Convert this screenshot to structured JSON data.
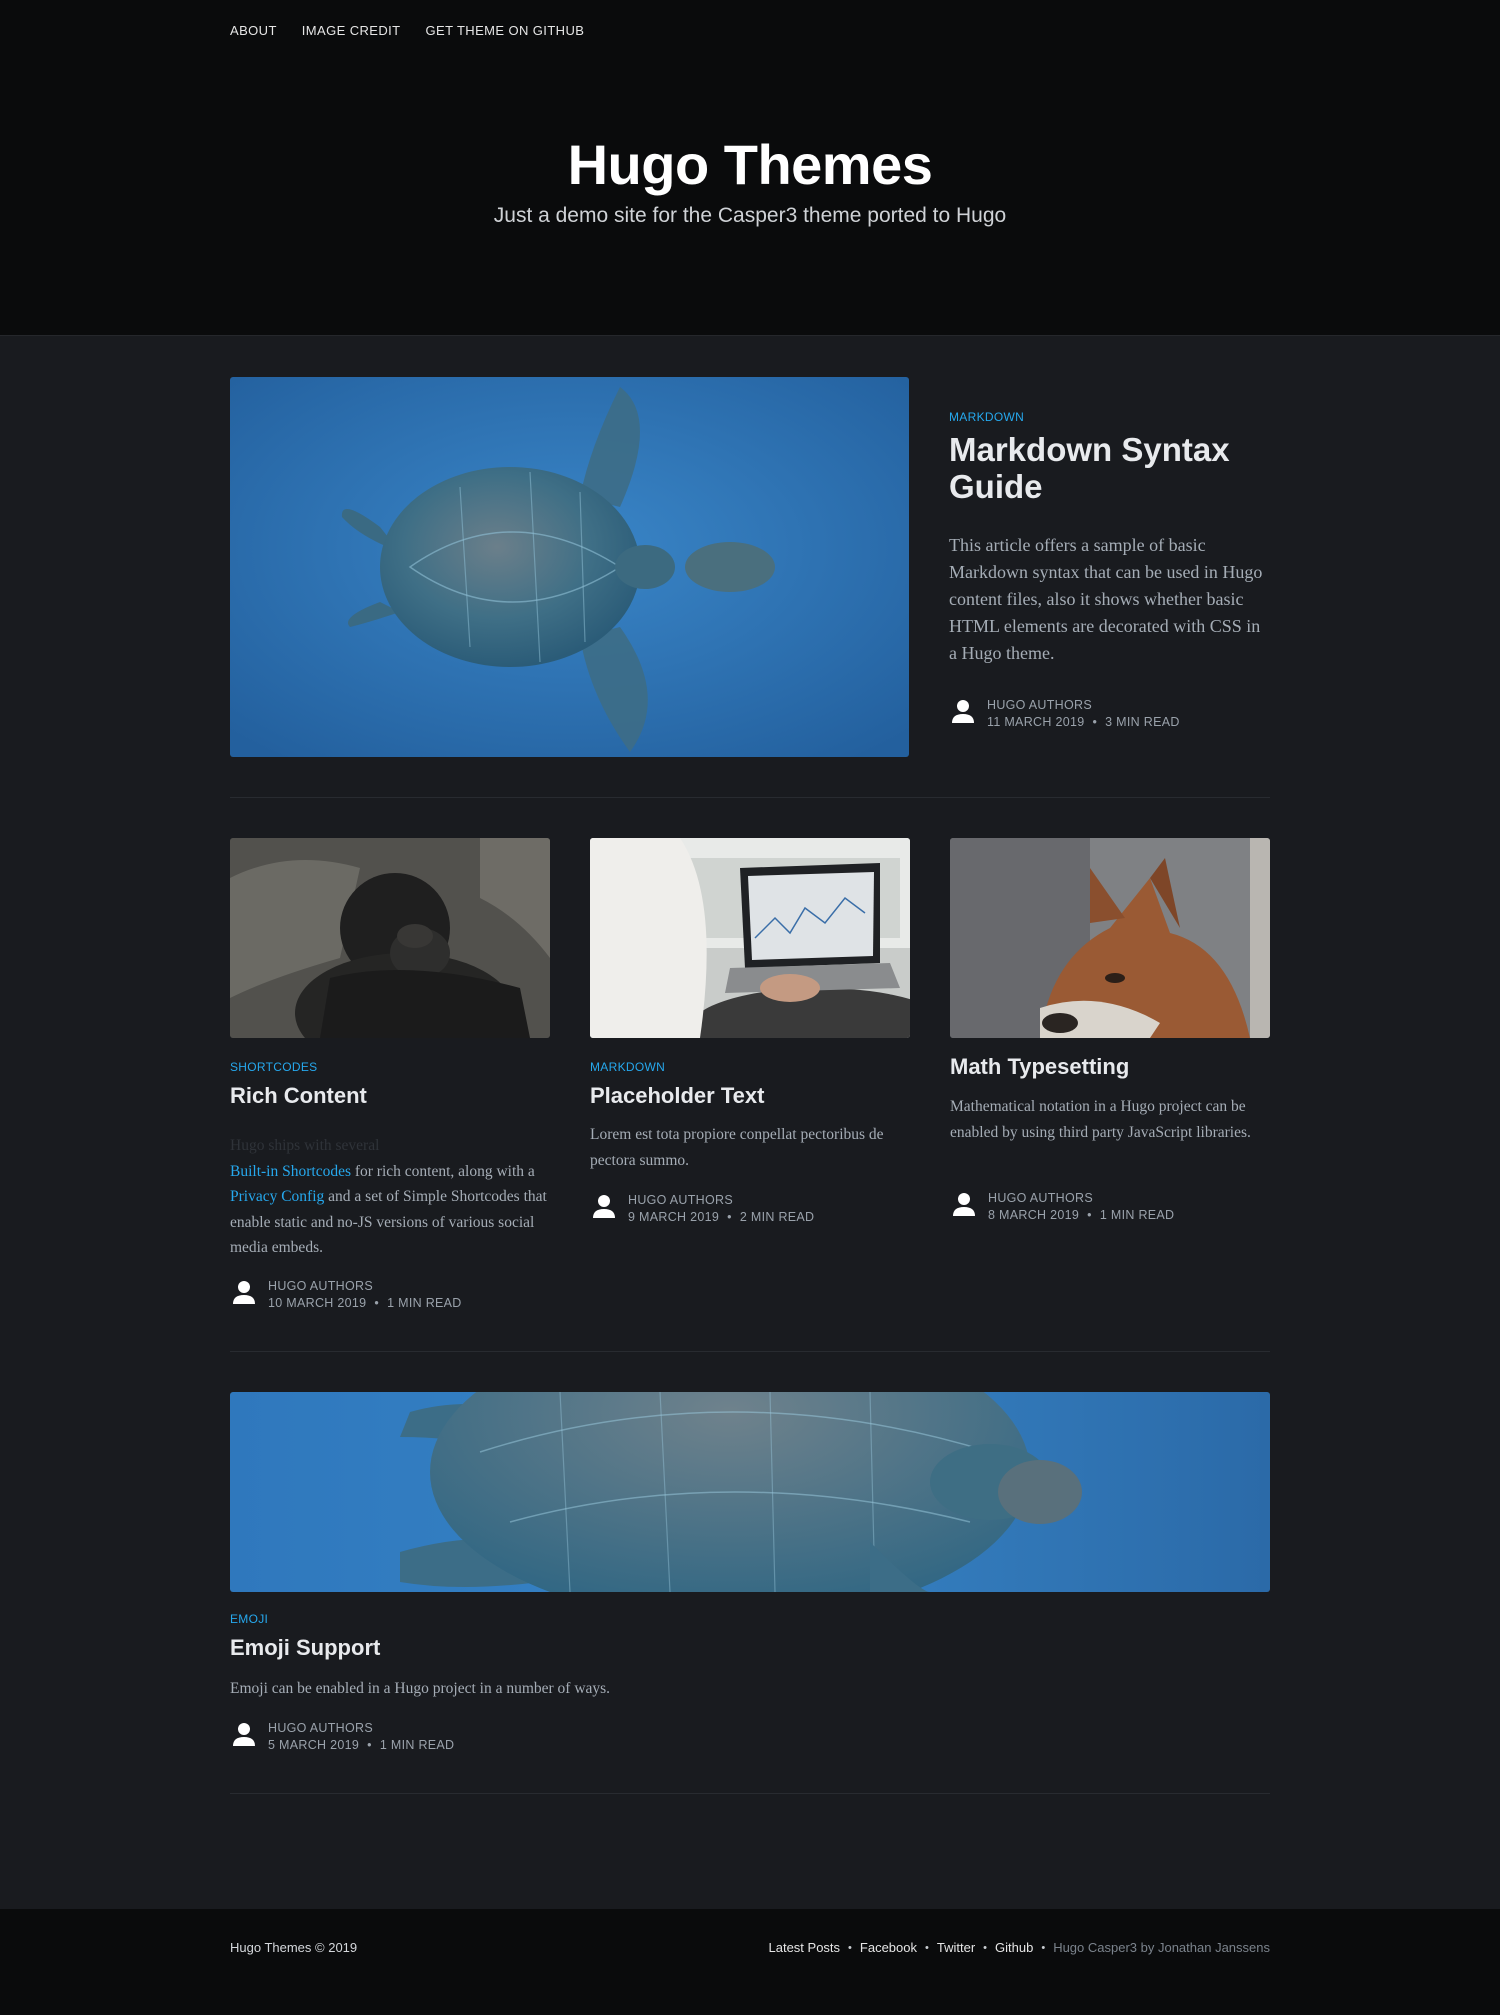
{
  "nav": {
    "items": [
      "About",
      "Image Credit",
      "Get Theme on GitHub"
    ]
  },
  "header": {
    "title": "Hugo Themes",
    "description": "Just a demo site for the Casper3 theme ported to Hugo"
  },
  "featured": {
    "tag": "Markdown",
    "title": "Markdown Syntax Guide",
    "excerpt": "This article offers a sample of basic Markdown syntax that can be used in Hugo content files, also it shows whether basic HTML elements are decorated with CSS in a Hugo theme.",
    "author": "Hugo Authors",
    "date": "11 March 2019",
    "read": "3 min read"
  },
  "cards": [
    {
      "tag": "Shortcodes",
      "title": "Rich Content",
      "excerpt_faint": "Hugo ships with several",
      "link1": "Built-in Shortcodes",
      "text1": " for rich content, along with a ",
      "link2": "Privacy Config",
      "text2": " and a set of Simple Shortcodes that enable static and no-JS versions of various social media embeds.",
      "author": "Hugo Authors",
      "date": "10 March 2019",
      "read": "1 min read"
    },
    {
      "tag": "Markdown",
      "title": "Placeholder Text",
      "excerpt": "Lorem est tota propiore conpellat pectoribus de pectora summo.",
      "author": "Hugo Authors",
      "date": "9 March 2019",
      "read": "2 min read"
    },
    {
      "tag": "",
      "title": "Math Typesetting",
      "excerpt": "Mathematical notation in a Hugo project can be enabled by using third party JavaScript libraries.",
      "author": "Hugo Authors",
      "date": "8 March 2019",
      "read": "1 min read"
    }
  ],
  "wide": {
    "tag": "Emoji",
    "title": "Emoji Support",
    "excerpt": "Emoji can be enabled in a Hugo project in a number of ways.",
    "author": "Hugo Authors",
    "date": "5 March 2019",
    "read": "1 min read"
  },
  "footer": {
    "copyright": "Hugo Themes © 2019",
    "links": [
      "Latest Posts",
      "Facebook",
      "Twitter",
      "Github"
    ],
    "credit": "Hugo Casper3 by Jonathan Janssens"
  },
  "separator": "•",
  "colors": {
    "accent": "#26a8ed",
    "background": "#191b1f",
    "header": "#0a0b0c"
  },
  "icons": [
    "author-avatar-icon",
    "turtle-image",
    "gorilla-image",
    "laptop-image",
    "fox-image"
  ]
}
